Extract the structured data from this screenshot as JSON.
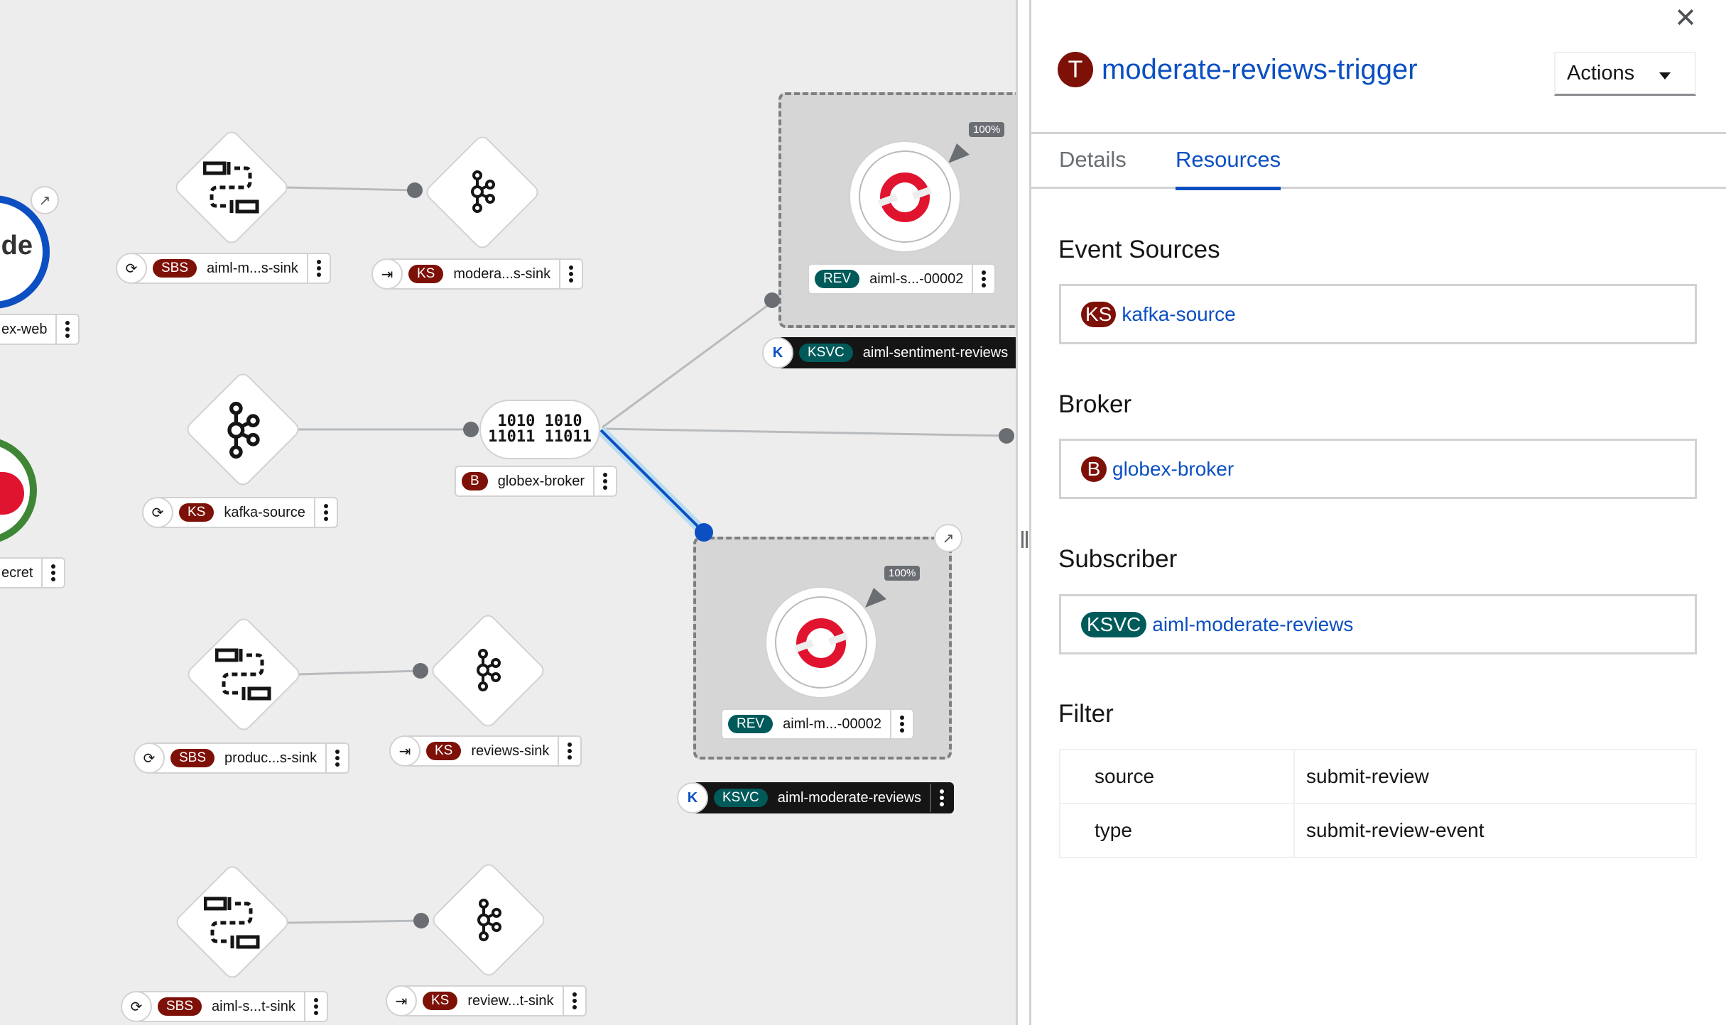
{
  "panel": {
    "close_icon": "close-icon",
    "title_badge": "T",
    "title": "moderate-reviews-trigger",
    "actions_label": "Actions",
    "tabs": [
      {
        "label": "Details",
        "active": false
      },
      {
        "label": "Resources",
        "active": true
      }
    ],
    "event_sources": {
      "heading": "Event Sources",
      "items": [
        {
          "badge": "KS",
          "name": "kafka-source"
        }
      ]
    },
    "broker": {
      "heading": "Broker",
      "items": [
        {
          "badge": "B",
          "name": "globex-broker"
        }
      ]
    },
    "subscriber": {
      "heading": "Subscriber",
      "items": [
        {
          "badge": "KSVC",
          "name": "aiml-moderate-reviews"
        }
      ]
    },
    "filter": {
      "heading": "Filter",
      "rows": [
        {
          "key": "source",
          "value": "submit-review"
        },
        {
          "key": "type",
          "value": "submit-review-event"
        }
      ]
    }
  },
  "topology": {
    "nodes": {
      "globex_web": {
        "label": "ex-web"
      },
      "secret": {
        "label": "ecret"
      },
      "sbs1": {
        "badge": "SBS",
        "label": "aiml-m...s-sink"
      },
      "ks1": {
        "badge": "KS",
        "label": "modera...s-sink"
      },
      "kafka_source": {
        "badge": "KS",
        "label": "kafka-source"
      },
      "broker": {
        "badge": "B",
        "label": "globex-broker",
        "icon_text_1": "1010 1010",
        "icon_text_2": "11011 11011"
      },
      "sbs2": {
        "badge": "SBS",
        "label": "produc...s-sink"
      },
      "ks2": {
        "badge": "KS",
        "label": "reviews-sink"
      },
      "sbs3": {
        "badge": "SBS",
        "label": "aiml-s...t-sink"
      },
      "ks3": {
        "badge": "KS",
        "label": "review...t-sink"
      },
      "rev1": {
        "badge": "REV",
        "label": "aiml-s...-00002",
        "traffic": "100%"
      },
      "ksvc1": {
        "badge": "KSVC",
        "label": "aiml-sentiment-reviews"
      },
      "rev2": {
        "badge": "REV",
        "label": "aiml-m...-00002",
        "traffic": "100%"
      },
      "ksvc2": {
        "badge": "KSVC",
        "label": "aiml-moderate-reviews"
      }
    },
    "colors": {
      "selected_edge": "#0b4fc2",
      "selected_edge_halo": "#b8dcf2",
      "badge_red": "#7d1007",
      "badge_teal": "#005a5a",
      "openshift_red": "#e0142f"
    }
  }
}
